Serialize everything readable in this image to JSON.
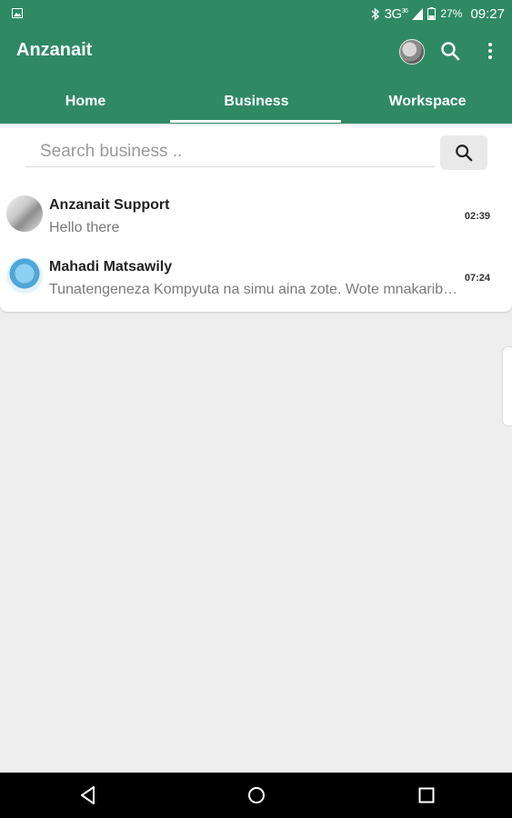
{
  "status_bar": {
    "icons": [
      "image-icon",
      "bluetooth-icon",
      "signal-icon",
      "battery-icon"
    ],
    "network": "3G",
    "network_sup": "36",
    "battery": "27%",
    "time": "09:27"
  },
  "app_bar": {
    "title": "Anzanait",
    "icons": [
      "profile-avatar",
      "search-icon",
      "more-vert-icon"
    ]
  },
  "tabs": [
    {
      "label": "Home",
      "selected": false
    },
    {
      "label": "Business",
      "selected": true
    },
    {
      "label": "Workspace",
      "selected": false
    }
  ],
  "search": {
    "placeholder": "Search business ..",
    "button_icon": "search-icon"
  },
  "chats": [
    {
      "name": "Anzanait Support",
      "preview": "Hello there",
      "time": "02:39"
    },
    {
      "name": "Mahadi Matsawily",
      "preview": "Tunatengeneza Kompyuta na simu aina zote. Wote mnakaribishwa",
      "time": "07:24"
    }
  ],
  "nav_bar": {
    "icons": [
      "back-icon",
      "home-icon",
      "recents-icon"
    ]
  },
  "colors": {
    "primary": "#2f8a64",
    "background": "#eeeeee",
    "card": "#ffffff"
  }
}
